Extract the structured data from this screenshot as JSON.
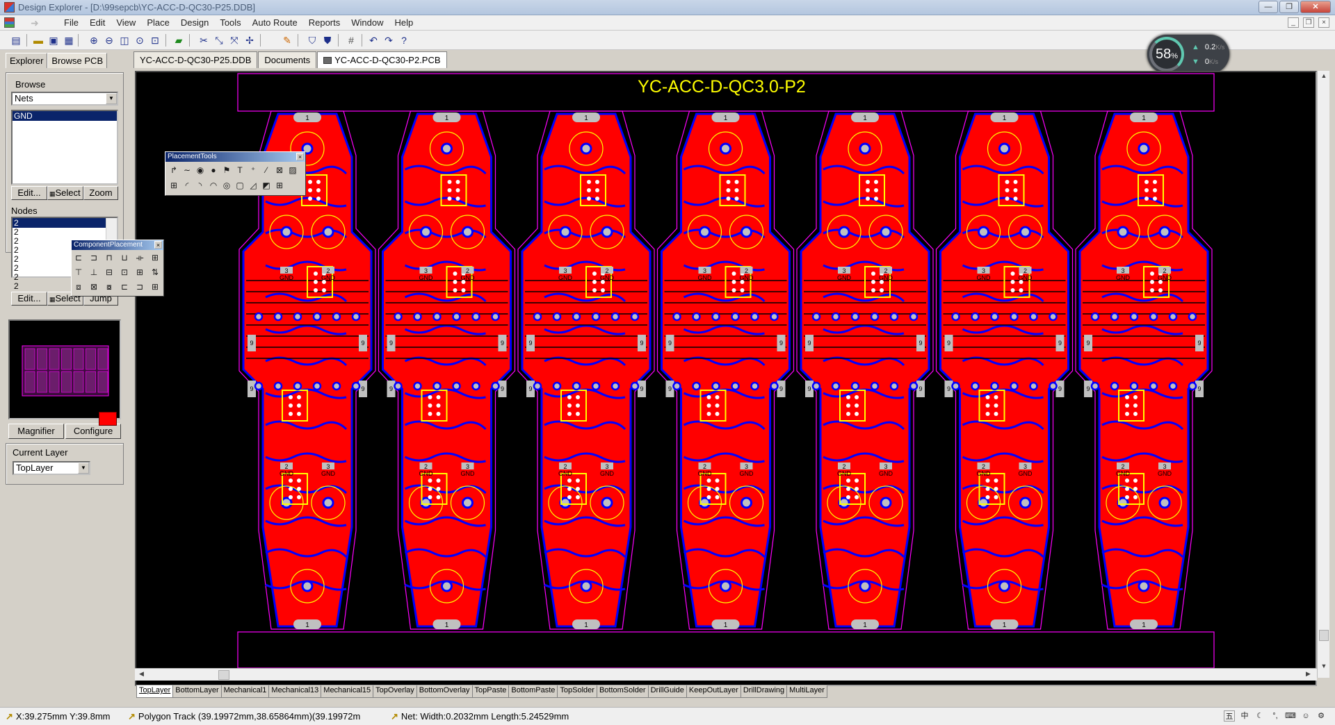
{
  "window": {
    "title": "Design Explorer - [D:\\99sepcb\\YC-ACC-D-QC30-P25.DDB]"
  },
  "menu": [
    "File",
    "Edit",
    "View",
    "Place",
    "Design",
    "Tools",
    "Auto Route",
    "Reports",
    "Window",
    "Help"
  ],
  "speed_widget": {
    "percent": "58",
    "percent_unit": "%",
    "up": "0.2",
    "up_unit": "K/s",
    "down": "0",
    "down_unit": "K/s"
  },
  "panel": {
    "tab_explorer": "Explorer",
    "tab_browse": "Browse PCB",
    "browse_label": "Browse",
    "browse_mode": "Nets",
    "nets": [
      "GND"
    ],
    "edit_label": "Edit...",
    "select_label": "Select",
    "zoom_label": "Zoom",
    "nodes_label": "Nodes",
    "nodes": [
      "2",
      "2",
      "2",
      "2",
      "2",
      "2",
      "2",
      "2"
    ],
    "jump_label": "Jump",
    "magnifier_label": "Magnifier",
    "configure_label": "Configure",
    "current_layer_label": "Current Layer",
    "current_layer_value": "TopLayer",
    "current_layer_color": "#ff0000"
  },
  "doc_tabs": [
    {
      "label": "YC-ACC-D-QC30-P25.DDB",
      "active": false
    },
    {
      "label": "Documents",
      "active": false
    },
    {
      "label": "YC-ACC-D-QC30-P2.PCB",
      "active": true
    }
  ],
  "pcb": {
    "board_title": "YC-ACC-D-QC3.0-P2",
    "panel_count": 7,
    "pad_label_1": "1",
    "pad_label_2": "2",
    "pad_label_3": "3",
    "pad_label_9": "9",
    "gnd_label": "GND",
    "colors": {
      "top_copper": "#ff0000",
      "bottom_copper": "#0000ff",
      "overlay": "#ffff00",
      "outline": "#ff00ff",
      "pad": "#c0c0c0",
      "background": "#000000"
    }
  },
  "placement_tools": {
    "title": "PlacementTools"
  },
  "component_placement": {
    "title": "ComponentPlacement"
  },
  "layer_tabs": [
    "TopLayer",
    "BottomLayer",
    "Mechanical1",
    "Mechanical13",
    "Mechanical15",
    "TopOverlay",
    "BottomOverlay",
    "TopPaste",
    "BottomPaste",
    "TopSolder",
    "BottomSolder",
    "DrillGuide",
    "KeepOutLayer",
    "DrillDrawing",
    "MultiLayer"
  ],
  "status": {
    "coords": "X:39.275mm Y:39.8mm",
    "object": "Polygon Track (39.19972mm,38.65864mm)(39.19972m",
    "net": "Net: Width:0.2032mm Length:5.24529mm"
  },
  "tray": {
    "ime": "中"
  }
}
